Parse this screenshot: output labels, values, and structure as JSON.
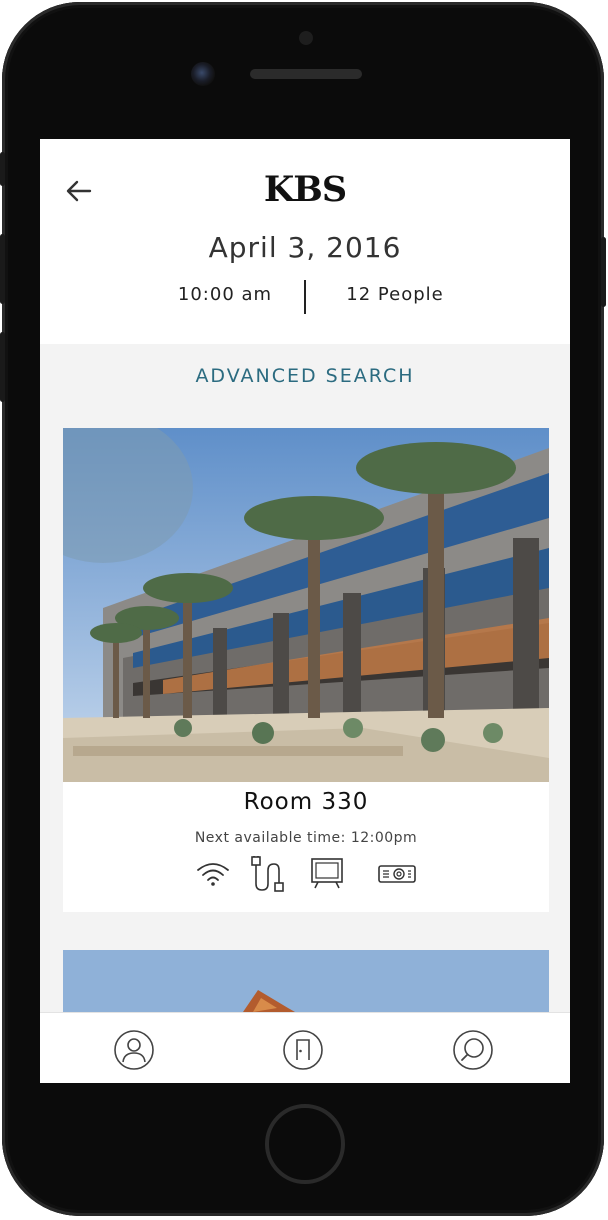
{
  "header": {
    "logo": "KBS",
    "date": "April 3, 2016",
    "time": "10:00 am",
    "people": "12 People"
  },
  "advanced_search_label": "ADVANCED SEARCH",
  "rooms": [
    {
      "name": "Room 330",
      "next_available": "Next available time: 12:00pm",
      "amenities": [
        "wifi-icon",
        "power-cable-icon",
        "tv-icon",
        "projector-icon"
      ]
    }
  ],
  "tabbar": {
    "items": [
      "profile-icon",
      "door-icon",
      "search-icon"
    ]
  },
  "colors": {
    "accent": "#2b6b80",
    "screen_bg": "#f3f3f3"
  }
}
